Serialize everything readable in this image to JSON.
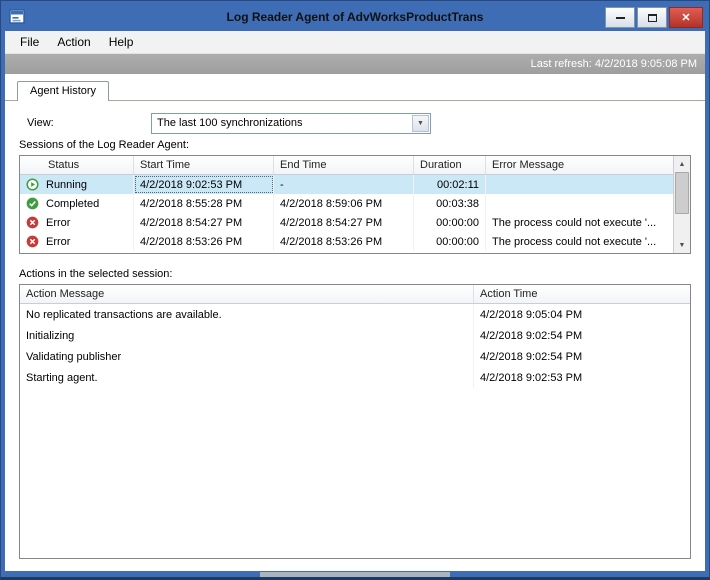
{
  "window": {
    "title": "Log Reader Agent of AdvWorksProductTrans"
  },
  "menu": {
    "items": [
      {
        "label": "File"
      },
      {
        "label": "Action"
      },
      {
        "label": "Help"
      }
    ]
  },
  "status": {
    "last_refresh": "Last refresh: 4/2/2018 9:05:08 PM"
  },
  "tabs": {
    "agent_history": "Agent History"
  },
  "view": {
    "label": "View:",
    "value": "The last 100 synchronizations"
  },
  "icons": {
    "dropdown": "▼",
    "scroll_up": "▲",
    "scroll_down": "▼"
  },
  "sessions": {
    "label": "Sessions of the Log Reader Agent:",
    "columns": [
      "Status",
      "Start Time",
      "End Time",
      "Duration",
      "Error Message"
    ],
    "rows": [
      {
        "status": "Running",
        "icon": "running",
        "start": "4/2/2018 9:02:53 PM",
        "end": "-",
        "duration": "00:02:11",
        "error": ""
      },
      {
        "status": "Completed",
        "icon": "completed",
        "start": "4/2/2018 8:55:28 PM",
        "end": "4/2/2018 8:59:06 PM",
        "duration": "00:03:38",
        "error": ""
      },
      {
        "status": "Error",
        "icon": "error",
        "start": "4/2/2018 8:54:27 PM",
        "end": "4/2/2018 8:54:27 PM",
        "duration": "00:00:00",
        "error": "The process could not execute '..."
      },
      {
        "status": "Error",
        "icon": "error",
        "start": "4/2/2018 8:53:26 PM",
        "end": "4/2/2018 8:53:26 PM",
        "duration": "00:00:00",
        "error": "The process could not execute '..."
      }
    ]
  },
  "actions": {
    "label": "Actions in the selected session:",
    "columns": [
      "Action Message",
      "Action Time"
    ],
    "rows": [
      {
        "message": "No replicated transactions are available.",
        "time": "4/2/2018 9:05:04 PM"
      },
      {
        "message": "Initializing",
        "time": "4/2/2018 9:02:54 PM"
      },
      {
        "message": "Validating publisher",
        "time": "4/2/2018 9:02:54 PM"
      },
      {
        "message": "Starting agent.",
        "time": "4/2/2018 9:02:53 PM"
      }
    ]
  },
  "colors": {
    "window_border": "#3E6DB5",
    "selection": "#CBE8F6",
    "running_green": "#3D9E3D",
    "error_red": "#C63A3A",
    "close_button_red": "#C04037"
  }
}
